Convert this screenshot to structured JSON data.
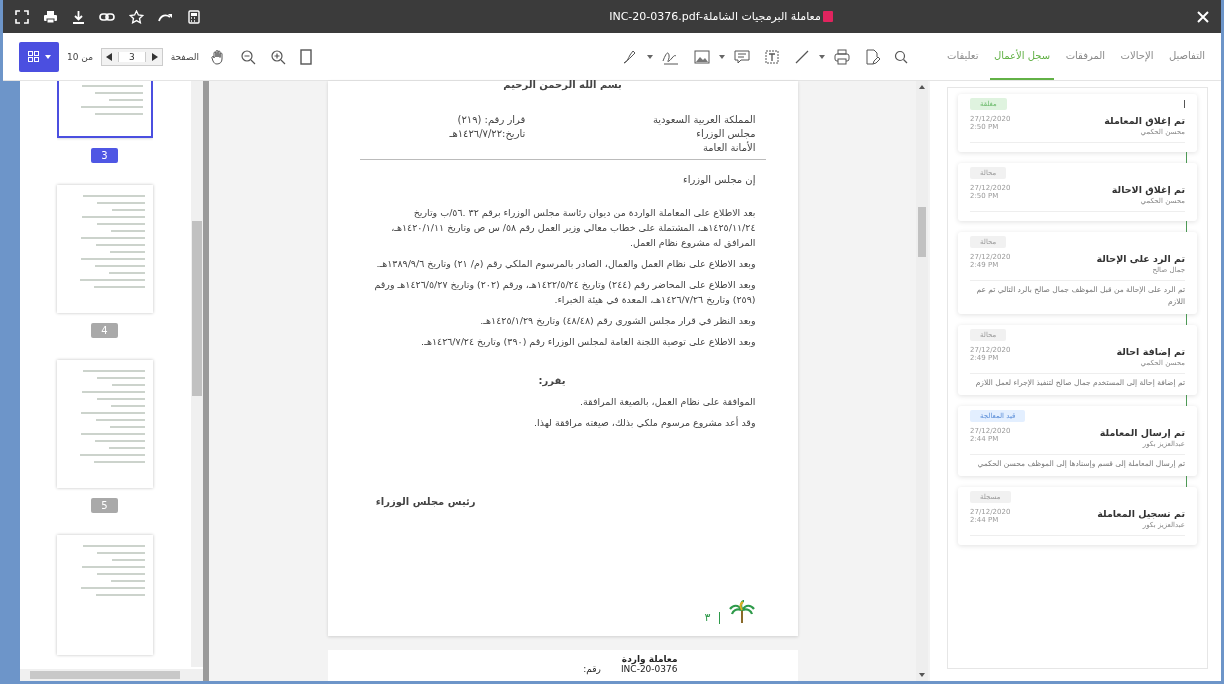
{
  "title_bar": {
    "title": "INC-20-0376.pdf-معاملة البرمجيات الشاملة"
  },
  "toolbar": {
    "page_label": "الصفحة",
    "page": "3",
    "total": "من 10"
  },
  "tabs": [
    {
      "label": "التفاصيل",
      "selected": false
    },
    {
      "label": "الإحالات",
      "selected": false
    },
    {
      "label": "المرفقات",
      "selected": false
    },
    {
      "label": "سجل الأعمال",
      "selected": true
    },
    {
      "label": "تعليقات",
      "selected": false
    }
  ],
  "thumbnails": [
    {
      "page": "3",
      "selected": true
    },
    {
      "page": "4",
      "selected": false
    },
    {
      "page": "5",
      "selected": false
    }
  ],
  "document": {
    "basmala": "بسم الله الرحمن الرحيم",
    "header_right": [
      "المملكة العربية السعودية",
      "مجلس الوزراء",
      "الأمانة العامة"
    ],
    "header_left": [
      "قرار رقم: (٢١٩)",
      "تاريخ:١٤٢٦/٧/٢٢هـ"
    ],
    "opening": "إن مجلس الوزراء",
    "paragraphs": [
      "بعد الاطلاع على المعاملة الواردة من ديوان رئاسة مجلس الوزراء برقم ٣٢ .٥٦/ب وتاريخ ١٤٢٥/١١/٢٤هـ، المشتملة على خطاب معالي وزير العمل رقم ٥٨/ س ص وتاريخ ١٤٢٠/١/١١هـ، المرافق له مشروع نظام العمل.",
      "وبعد الاطلاع على نظام العمل والعمال، الصادر بالمرسوم الملكي رقم (م/ ٢١) وتاريخ ١٣٨٩/٩/٦هـ.",
      "وبعد الاطلاع على المحاضر رقم (٢٤٤) وتاريخ ١٤٢٢/٥/٢٤هـ، ورقم (٢٠٢) وتاريخ ١٤٢٦/٥/٢٧هـ ورقم (٢٥٩) وتاريخ ١٤٢٦/٧/٢٦هـ، المعدة في هيئة الخبراء.",
      "وبعد النظر في قرار مجلس الشورى رقم (٤٨/٤٨) وتاريخ ١٤٢٥/١/٢٩هـ.",
      "وبعد الاطلاع على توصية اللجنة العامة لمجلس الوزراء رقم (٣٩٠) وتاريخ ١٤٢٦/٧/٢٤هـ."
    ],
    "decides": "يقرر:",
    "decisions": [
      "الموافقة على نظام العمل، بالصيغة المرافقة.",
      "وقد أعد مشروع مرسوم ملكي بذلك، صيغته مرافقة لهذا."
    ],
    "signature": "رئيس مجلس الوزراء",
    "page_number": "٣"
  },
  "next_page": {
    "heading": "معاملة واردة",
    "label": "رقم:",
    "number": "INC-20-0376"
  },
  "timeline": [
    {
      "kind": "closed",
      "badge": "مغلقة",
      "title": "تم إغلاق المعاملة",
      "user": "محسن الحكمي",
      "date": "27/12/2020",
      "time": "2:50 PM"
    },
    {
      "kind": "referred",
      "badge": "محالة",
      "title": "تم إغلاق الاحالة",
      "user": "محسن الحكمي",
      "date": "27/12/2020",
      "time": "2:50 PM"
    },
    {
      "kind": "referred",
      "badge": "محالة",
      "title": "تم الرد على الإحالة",
      "user": "جمال صالح",
      "date": "27/12/2020",
      "time": "2:49 PM",
      "note": "تم الرد على الإحالة من قبل الموظف جمال صالح بالرد التالي تم عم اللازم"
    },
    {
      "kind": "referred",
      "badge": "محالة",
      "title": "تم إضافة احالة",
      "user": "محسن الحكمي",
      "date": "27/12/2020",
      "time": "2:49 PM",
      "note": "تم إضافة إحالة إلى المستخدم جمال صالح لتنفيذ الإجراء لعمل اللازم"
    },
    {
      "kind": "processing",
      "badge": "قيد المعالجة",
      "title": "تم إرسال المعاملة",
      "user": "عبدالعزيز بكور",
      "date": "27/12/2020",
      "time": "2:44 PM",
      "note": "تم إرسال المعاملة إلى قسم وإسنادها إلى الموظف محسن الحكمي"
    },
    {
      "kind": "registered",
      "badge": "مسجلة",
      "title": "تم تسجيل المعاملة",
      "user": "عبدالعزيز بكور",
      "date": "27/12/2020",
      "time": "2:44 PM"
    }
  ]
}
